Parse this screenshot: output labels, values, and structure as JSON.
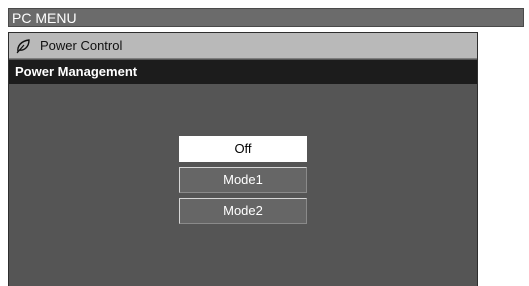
{
  "menu": {
    "title": "PC MENU"
  },
  "panel": {
    "icon": "leaf-icon",
    "title": "Power Control",
    "section": "Power Management",
    "options": [
      {
        "label": "Off",
        "selected": true
      },
      {
        "label": "Mode1",
        "selected": false
      },
      {
        "label": "Mode2",
        "selected": false
      }
    ]
  },
  "colors": {
    "menu_bar": "#6b6b6b",
    "panel_bg": "#555555",
    "header_bg": "#b9b9b9",
    "section_bg": "#1c1c1c",
    "selected_option": "#ffffff"
  }
}
